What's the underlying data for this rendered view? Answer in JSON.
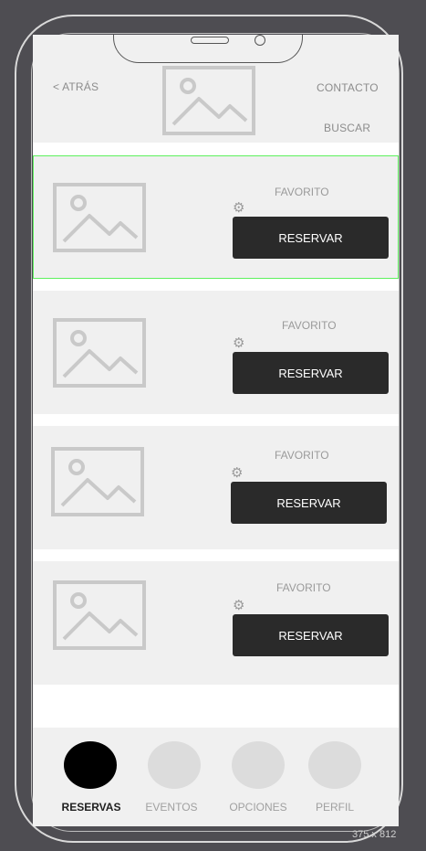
{
  "header": {
    "back_label": "< ATRÁS",
    "contact_label": "CONTACTO",
    "search_label": "BUSCAR"
  },
  "cards": [
    {
      "favorite_label": "FAVORITO",
      "reserve_label": "RESERVAR",
      "selected": true
    },
    {
      "favorite_label": "FAVORITO",
      "reserve_label": "RESERVAR",
      "selected": false
    },
    {
      "favorite_label": "FAVORITO",
      "reserve_label": "RESERVAR",
      "selected": false
    },
    {
      "favorite_label": "FAVORITO",
      "reserve_label": "RESERVAR",
      "selected": false
    }
  ],
  "tabs": [
    {
      "label": "RESERVAS",
      "active": true
    },
    {
      "label": "EVENTOS",
      "active": false
    },
    {
      "label": "OPCIONES",
      "active": false
    },
    {
      "label": "PERFIL",
      "active": false
    }
  ],
  "artboard_size_label": "375 x 812",
  "colors": {
    "background": "#4e4d52",
    "panel": "#f0f0f0",
    "button": "#2a2a2a",
    "selection": "#5ef15e",
    "active_tab": "#000000"
  },
  "icons": {
    "image_placeholder": "image-placeholder-icon",
    "gear": "gear-icon"
  }
}
